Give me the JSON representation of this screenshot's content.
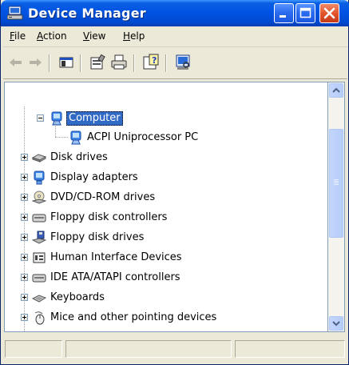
{
  "window": {
    "title": "Device Manager"
  },
  "menu": [
    {
      "label_u": "F",
      "label_rest": "ile"
    },
    {
      "label_u": "A",
      "label_rest": "ction"
    },
    {
      "label_u": "V",
      "label_rest": "iew"
    },
    {
      "label_u": "H",
      "label_rest": "elp"
    }
  ],
  "toolbar": {
    "icons": [
      "back-arrow-icon",
      "forward-arrow-icon",
      "show-hide-console-tree-icon",
      "properties-icon",
      "print-icon",
      "help-icon",
      "scan-hardware-icon"
    ]
  },
  "tree": {
    "items": [
      {
        "label": "Computer",
        "state": "expanded",
        "selected": true,
        "icon": "computer-icon"
      },
      {
        "label": "ACPI Uniprocessor PC",
        "state": "leaf",
        "icon": "computer-icon"
      },
      {
        "label": "Disk drives",
        "state": "collapsed",
        "icon": "disk-drive-icon"
      },
      {
        "label": "Display adapters",
        "state": "collapsed",
        "icon": "display-adapter-icon"
      },
      {
        "label": "DVD/CD-ROM drives",
        "state": "collapsed",
        "icon": "cd-drive-icon"
      },
      {
        "label": "Floppy disk controllers",
        "state": "collapsed",
        "icon": "controller-icon"
      },
      {
        "label": "Floppy disk drives",
        "state": "collapsed",
        "icon": "floppy-drive-icon"
      },
      {
        "label": "Human Interface Devices",
        "state": "collapsed",
        "icon": "hid-icon"
      },
      {
        "label": "IDE ATA/ATAPI controllers",
        "state": "collapsed",
        "icon": "controller-icon"
      },
      {
        "label": "Keyboards",
        "state": "collapsed",
        "icon": "keyboard-icon"
      },
      {
        "label": "Mice and other pointing devices",
        "state": "collapsed",
        "icon": "mouse-icon"
      }
    ]
  },
  "colors": {
    "titlebar": "#0054e3",
    "selection": "#316ac5",
    "close_button": "#e3552c"
  }
}
